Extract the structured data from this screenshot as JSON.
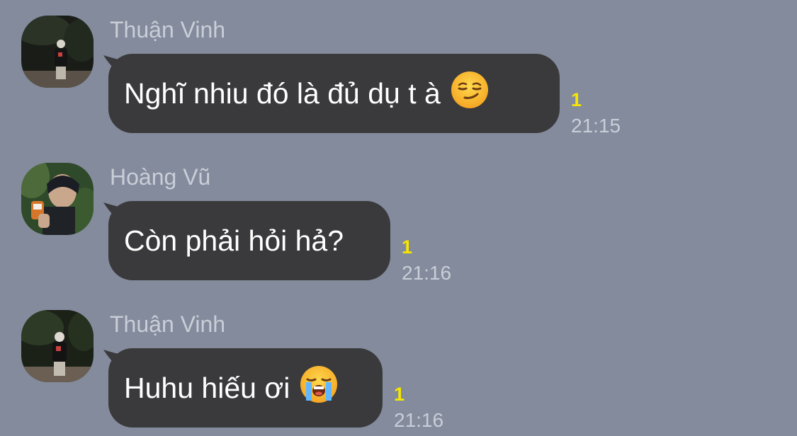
{
  "messages": [
    {
      "sender": "Thuận Vinh",
      "avatar_icon": "avatar-icon",
      "text": "Nghĩ nhiu đó là đủ dụ t à",
      "emoji": "smirking-face-icon",
      "unread_count": "1",
      "time": "21:15"
    },
    {
      "sender": "Hoàng Vũ",
      "avatar_icon": "avatar-icon",
      "text": "Còn phải hỏi hả?",
      "emoji": "",
      "unread_count": "1",
      "time": "21:16"
    },
    {
      "sender": "Thuận Vinh",
      "avatar_icon": "avatar-icon",
      "text": "Huhu hiếu ơi",
      "emoji": "loudly-crying-face-icon",
      "unread_count": "1",
      "time": "21:16"
    }
  ],
  "colors": {
    "background": "#838b9c",
    "bubble": "#3a3a3c",
    "bubble_text": "#ffffff",
    "sender_text": "#c9ced8",
    "unread": "#f7e600",
    "time_text": "#c9ced8"
  }
}
